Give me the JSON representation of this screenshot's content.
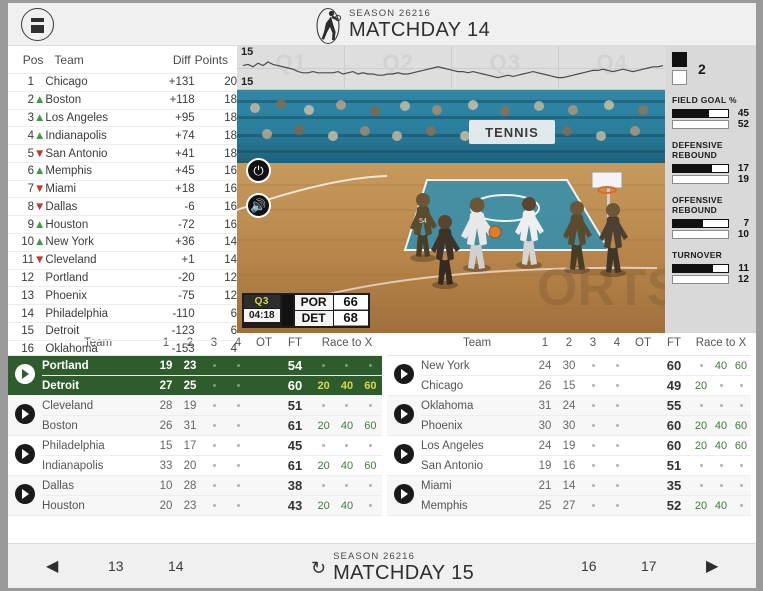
{
  "header": {
    "logo_icon": "menu-circle-icon",
    "season_label": "SEASON 26216",
    "matchday_label": "MATCHDAY 14",
    "player_icon": "basketball-player-icon"
  },
  "standings": {
    "columns": [
      "Pos",
      "Team",
      "Diff",
      "Points"
    ],
    "rows": [
      {
        "pos": "1",
        "trend": "",
        "team": "Chicago",
        "diff": "+131",
        "points": "20"
      },
      {
        "pos": "2",
        "trend": "up",
        "team": "Boston",
        "diff": "+118",
        "points": "18"
      },
      {
        "pos": "3",
        "trend": "up",
        "team": "Los Angeles",
        "diff": "+95",
        "points": "18"
      },
      {
        "pos": "4",
        "trend": "up",
        "team": "Indianapolis",
        "diff": "+74",
        "points": "18"
      },
      {
        "pos": "5",
        "trend": "down",
        "team": "San Antonio",
        "diff": "+41",
        "points": "18"
      },
      {
        "pos": "6",
        "trend": "up",
        "team": "Memphis",
        "diff": "+45",
        "points": "16"
      },
      {
        "pos": "7",
        "trend": "down",
        "team": "Miami",
        "diff": "+18",
        "points": "16"
      },
      {
        "pos": "8",
        "trend": "down",
        "team": "Dallas",
        "diff": "-6",
        "points": "16"
      },
      {
        "pos": "9",
        "trend": "up",
        "team": "Houston",
        "diff": "-72",
        "points": "16"
      },
      {
        "pos": "10",
        "trend": "up",
        "team": "New York",
        "diff": "+36",
        "points": "14"
      },
      {
        "pos": "11",
        "trend": "down",
        "team": "Cleveland",
        "diff": "+1",
        "points": "14"
      },
      {
        "pos": "12",
        "trend": "",
        "team": "Portland",
        "diff": "-20",
        "points": "12"
      },
      {
        "pos": "13",
        "trend": "",
        "team": "Phoenix",
        "diff": "-75",
        "points": "12"
      },
      {
        "pos": "14",
        "trend": "",
        "team": "Philadelphia",
        "diff": "-110",
        "points": "6"
      },
      {
        "pos": "15",
        "trend": "",
        "team": "Detroit",
        "diff": "-123",
        "points": "6"
      },
      {
        "pos": "16",
        "trend": "",
        "team": "Oklahoma",
        "diff": "-153",
        "points": "4"
      }
    ]
  },
  "chart_data": {
    "type": "line",
    "title": "",
    "quarter_labels": [
      "Q1",
      "Q2",
      "Q3",
      "Q4"
    ],
    "top_value": "15",
    "bottom_value": "15",
    "ylabel": "",
    "xlabel": "",
    "ylim": [
      -15,
      15
    ],
    "grid": true,
    "series": [
      {
        "name": "score-differential",
        "values": [
          2,
          3,
          1,
          4,
          2,
          5,
          3,
          2,
          1,
          0,
          -1,
          -3,
          -4,
          -4,
          -3,
          -4,
          -4,
          -4,
          -4,
          -3,
          -5,
          -4,
          -3,
          -5,
          -4,
          -5,
          -5,
          -6,
          -6,
          -5,
          -5,
          -4,
          -5,
          -5,
          -4,
          -3,
          -2,
          -1,
          0,
          1,
          0,
          -1,
          -2,
          -3,
          -3,
          -4,
          -3,
          -4,
          -5,
          -6,
          -7,
          -8,
          -7,
          -6,
          -7,
          -6,
          -5,
          -4,
          -3,
          -4,
          -5,
          -6,
          -7,
          -8,
          -8,
          -7,
          -6,
          -5,
          -4,
          -3,
          -2,
          -2,
          -1,
          -2,
          -3,
          -2,
          -1,
          -2,
          -3,
          -2,
          -1,
          0,
          1,
          1,
          2
        ]
      }
    ]
  },
  "video": {
    "power_icon": "power-icon",
    "sound_icon": "speaker-icon",
    "scorebug": {
      "quarter": "Q3",
      "clock": "04:18",
      "away_abbr": "POR",
      "away_score": "66",
      "home_abbr": "DET",
      "home_score": "68"
    }
  },
  "stats_panel": {
    "lead": {
      "dark_swatch": "black-team-swatch",
      "light_swatch": "white-team-swatch",
      "value": "2"
    },
    "blocks": [
      {
        "title": "FIELD GOAL %",
        "dark_value": "45",
        "light_value": "52",
        "dark_pct": 65,
        "light_pct": 100
      },
      {
        "title": "DEFENSIVE REBOUND",
        "dark_value": "17",
        "light_value": "19",
        "dark_pct": 70,
        "light_pct": 100
      },
      {
        "title": "OFFENSIVE REBOUND",
        "dark_value": "7",
        "light_value": "10",
        "dark_pct": 55,
        "light_pct": 100
      },
      {
        "title": "TURNOVER",
        "dark_value": "11",
        "light_value": "12",
        "dark_pct": 72,
        "light_pct": 100
      }
    ]
  },
  "match_lists": {
    "columns": [
      "Team",
      "1",
      "2",
      "3",
      "4",
      "OT",
      "FT",
      "Race to X"
    ],
    "left": [
      {
        "selected": true,
        "away": {
          "team": "Portland",
          "q1": "19",
          "q2": "23",
          "q3": "·",
          "q4": "·",
          "ot": "",
          "ft": "54",
          "race": [
            "·",
            "·",
            "·"
          ]
        },
        "home": {
          "team": "Detroit",
          "q1": "27",
          "q2": "25",
          "q3": "·",
          "q4": "·",
          "ot": "",
          "ft": "60",
          "race": [
            "20",
            "40",
            "60"
          ]
        }
      },
      {
        "selected": false,
        "away": {
          "team": "Cleveland",
          "q1": "28",
          "q2": "19",
          "q3": "·",
          "q4": "·",
          "ot": "",
          "ft": "51",
          "race": [
            "·",
            "·",
            "·"
          ]
        },
        "home": {
          "team": "Boston",
          "q1": "26",
          "q2": "31",
          "q3": "·",
          "q4": "·",
          "ot": "",
          "ft": "61",
          "race": [
            "20",
            "40",
            "60"
          ]
        }
      },
      {
        "selected": false,
        "away": {
          "team": "Philadelphia",
          "q1": "15",
          "q2": "17",
          "q3": "·",
          "q4": "·",
          "ot": "",
          "ft": "45",
          "race": [
            "·",
            "·",
            "·"
          ]
        },
        "home": {
          "team": "Indianapolis",
          "q1": "33",
          "q2": "20",
          "q3": "·",
          "q4": "·",
          "ot": "",
          "ft": "61",
          "race": [
            "20",
            "40",
            "60"
          ]
        }
      },
      {
        "selected": false,
        "away": {
          "team": "Dallas",
          "q1": "10",
          "q2": "28",
          "q3": "·",
          "q4": "·",
          "ot": "",
          "ft": "38",
          "race": [
            "·",
            "·",
            "·"
          ]
        },
        "home": {
          "team": "Houston",
          "q1": "20",
          "q2": "23",
          "q3": "·",
          "q4": "·",
          "ot": "",
          "ft": "43",
          "race": [
            "20",
            "40",
            "·"
          ]
        }
      }
    ],
    "right": [
      {
        "selected": false,
        "away": {
          "team": "New York",
          "q1": "24",
          "q2": "30",
          "q3": "·",
          "q4": "·",
          "ot": "",
          "ft": "60",
          "race": [
            "·",
            "40",
            "60"
          ]
        },
        "home": {
          "team": "Chicago",
          "q1": "26",
          "q2": "15",
          "q3": "·",
          "q4": "·",
          "ot": "",
          "ft": "49",
          "race": [
            "20",
            "·",
            "·"
          ]
        }
      },
      {
        "selected": false,
        "away": {
          "team": "Oklahoma",
          "q1": "31",
          "q2": "24",
          "q3": "·",
          "q4": "·",
          "ot": "",
          "ft": "55",
          "race": [
            "·",
            "·",
            "·"
          ]
        },
        "home": {
          "team": "Phoenix",
          "q1": "30",
          "q2": "30",
          "q3": "·",
          "q4": "·",
          "ot": "",
          "ft": "60",
          "race": [
            "20",
            "40",
            "60"
          ]
        }
      },
      {
        "selected": false,
        "away": {
          "team": "Los Angeles",
          "q1": "24",
          "q2": "19",
          "q3": "·",
          "q4": "·",
          "ot": "",
          "ft": "60",
          "race": [
            "20",
            "40",
            "60"
          ]
        },
        "home": {
          "team": "San Antonio",
          "q1": "19",
          "q2": "16",
          "q3": "·",
          "q4": "·",
          "ot": "",
          "ft": "51",
          "race": [
            "·",
            "·",
            "·"
          ]
        }
      },
      {
        "selected": false,
        "away": {
          "team": "Miami",
          "q1": "21",
          "q2": "14",
          "q3": "·",
          "q4": "·",
          "ot": "",
          "ft": "35",
          "race": [
            "·",
            "·",
            "·"
          ]
        },
        "home": {
          "team": "Memphis",
          "q1": "25",
          "q2": "27",
          "q3": "·",
          "q4": "·",
          "ot": "",
          "ft": "52",
          "race": [
            "20",
            "40",
            "·"
          ]
        }
      }
    ]
  },
  "bottom_nav": {
    "prev_icon": "chevron-left-icon",
    "next_icon": "chevron-right-icon",
    "refresh_icon": "refresh-icon",
    "left_pages": [
      "13",
      "14"
    ],
    "right_pages": [
      "16",
      "17"
    ],
    "season_label": "SEASON 26216",
    "matchday_label": "MATCHDAY 15"
  }
}
